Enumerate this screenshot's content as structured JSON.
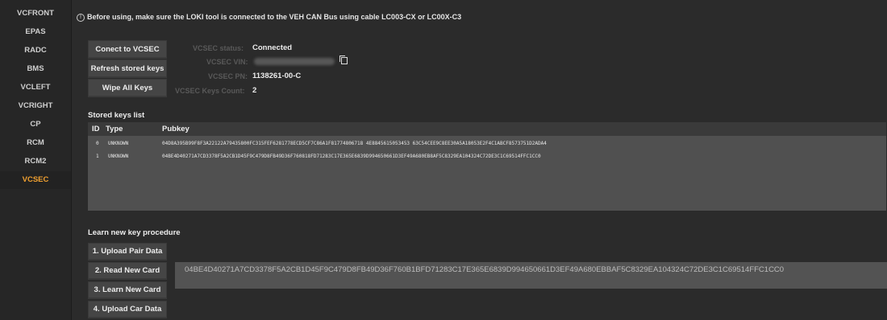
{
  "sidebar": {
    "items": [
      {
        "label": "VCFRONT"
      },
      {
        "label": "EPAS"
      },
      {
        "label": "RADC"
      },
      {
        "label": "BMS"
      },
      {
        "label": "VCLEFT"
      },
      {
        "label": "VCRIGHT"
      },
      {
        "label": "CP"
      },
      {
        "label": "RCM"
      },
      {
        "label": "RCM2"
      },
      {
        "label": "VCSEC",
        "active": true
      }
    ]
  },
  "notice": "Before using, make sure the LOKI tool is connected to the VEH CAN Bus using cable LC003-CX or LC00X-C3",
  "buttons": {
    "connect": "Conect to VCSEC",
    "refresh": "Refresh stored keys",
    "wipe": "Wipe All Keys"
  },
  "status": {
    "status_label": "VCSEC status:",
    "status_value": "Connected",
    "vin_label": "VCSEC VIN:",
    "pn_label": "VCSEC PN:",
    "pn_value": "1138261-00-C",
    "count_label": "VCSEC Keys Count:",
    "count_value": "2"
  },
  "stored_keys": {
    "title": "Stored keys list",
    "columns": [
      "ID",
      "Type",
      "Pubkey"
    ],
    "rows": [
      {
        "id": "0",
        "type": "UNKNOWN",
        "pubkey": "04D8A395B99F8F3A22122A79435800FC315FEF6281778ECD5CF7C86A1F81774806718 4E8845615053453 63C54CEE9C8EE30A5A18053E2F4C1ABCF8573751D2ADA4"
      },
      {
        "id": "1",
        "type": "UNKNOWN",
        "pubkey": "04BE4D40271A7CD3378F5A2CB1D45F9C479D8FB49D36F760818FD71283C17E365E6839D994650661D3EF49A680EB8AF5C8329EA104324C72DE3C1C69514FFC1CC0"
      }
    ]
  },
  "learn": {
    "title": "Learn new key procedure",
    "steps": [
      "1. Upload Pair Data",
      "2. Read New Card",
      "3. Learn New Card",
      "4. Upload Car Data"
    ],
    "card_value": "04BE4D40271A7CD3378F5A2CB1D45F9C479D8FB49D36F760B1BFD71283C17E365E6839D994650661D3EF49A680EBBAF5C8329EA104324C72DE3C1C69514FFC1CC0"
  },
  "colors": {
    "accent": "#f0a030",
    "background": "#2b2b2b",
    "panel": "#505050"
  }
}
